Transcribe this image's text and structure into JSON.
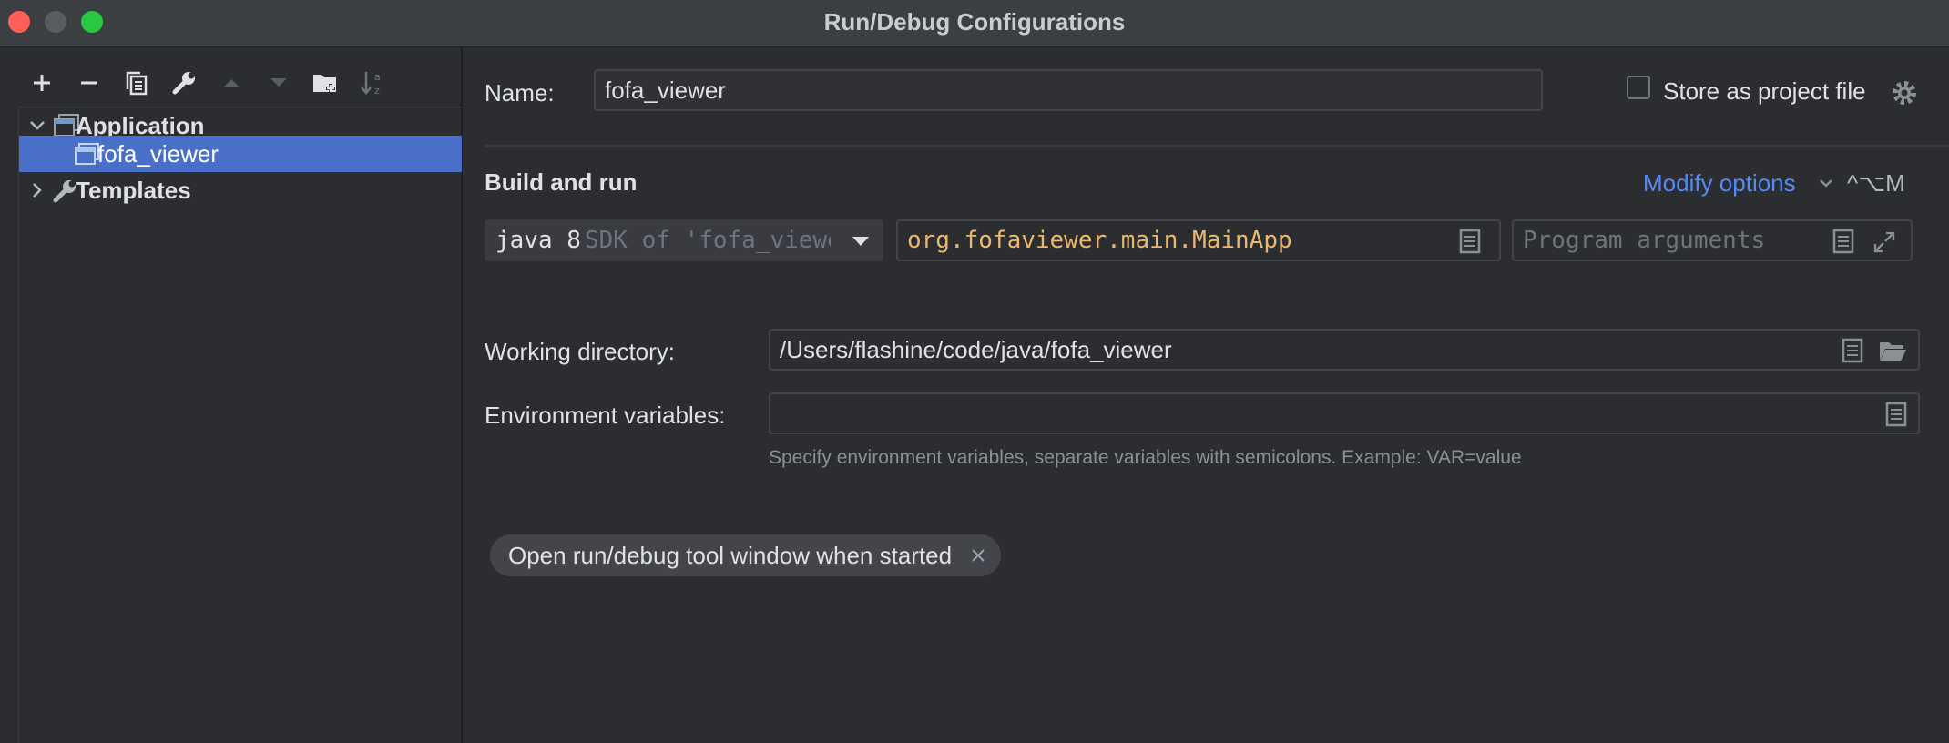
{
  "window": {
    "title": "Run/Debug Configurations"
  },
  "sidebar": {
    "toolbar": [
      {
        "name": "add-icon"
      },
      {
        "name": "remove-icon"
      },
      {
        "name": "copy-icon"
      },
      {
        "name": "wrench-icon"
      },
      {
        "name": "move-up-icon"
      },
      {
        "name": "move-down-icon"
      },
      {
        "name": "new-folder-icon"
      },
      {
        "name": "sort-alpha-icon"
      }
    ],
    "tree": {
      "application_label": "Application",
      "config_label": "fofa_viewer",
      "templates_label": "Templates"
    }
  },
  "form": {
    "name_label": "Name:",
    "name_value": "fofa_viewer",
    "store_label": "Store as project file",
    "store_checked": false,
    "section_title": "Build and run",
    "modify_options": "Modify options",
    "modify_shortcut": "^⌥M",
    "jdk_main": "java 8",
    "jdk_detail": "SDK of 'fofa_viewer'",
    "main_class": "org.fofaviewer.main.MainApp",
    "program_args_placeholder": "Program arguments",
    "workdir_label": "Working directory:",
    "workdir_value": "/Users/flashine/code/java/fofa_viewer",
    "env_label": "Environment variables:",
    "env_value": "",
    "env_hint": "Specify environment variables, separate variables with semicolons. Example: VAR=value",
    "chip_label": "Open run/debug tool window when started"
  },
  "colors": {
    "accent": "#4a6fc9",
    "link": "#548af7",
    "main_class_text": "#e8b86d",
    "background": "#2b2d30"
  }
}
